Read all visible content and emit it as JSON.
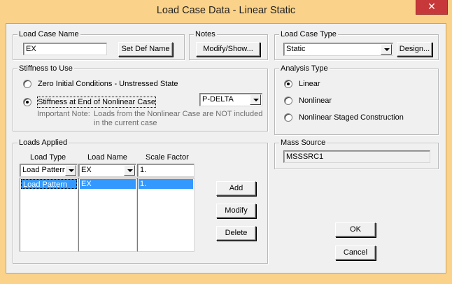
{
  "window": {
    "title": "Load Case Data - Linear Static",
    "close_glyph": "✕"
  },
  "load_case_name": {
    "legend": "Load Case Name",
    "value": "EX",
    "set_def_button": "Set Def Name"
  },
  "notes": {
    "legend": "Notes",
    "button": "Modify/Show..."
  },
  "load_case_type": {
    "legend": "Load Case Type",
    "selected": "Static",
    "design_button": "Design..."
  },
  "stiffness": {
    "legend": "Stiffness to Use",
    "option_zero": "Zero Initial Conditions - Unstressed State",
    "option_nonlinear": "Stiffness at End of Nonlinear Case",
    "nonlinear_case": "P-DELTA",
    "important_label": "Important Note:",
    "important_line1": "Loads from the Nonlinear Case are NOT included",
    "important_line2": "in the current case"
  },
  "analysis_type": {
    "legend": "Analysis Type",
    "options": [
      "Linear",
      "Nonlinear",
      "Nonlinear Staged Construction"
    ],
    "selected": "Linear"
  },
  "loads_applied": {
    "legend": "Loads Applied",
    "headers": [
      "Load Type",
      "Load Name",
      "Scale Factor"
    ],
    "edit_row": {
      "load_type": "Load Pattern",
      "load_name": "EX",
      "scale": "1."
    },
    "rows": [
      {
        "load_type": "Load Pattern",
        "load_name": "EX",
        "scale": "1."
      }
    ],
    "add_button": "Add",
    "modify_button": "Modify",
    "delete_button": "Delete"
  },
  "mass_source": {
    "legend": "Mass Source",
    "value": "MSSSRC1"
  },
  "buttons": {
    "ok": "OK",
    "cancel": "Cancel"
  },
  "colors": {
    "titlebar": "#fbd28a",
    "close": "#c7383a",
    "selection": "#3399ff",
    "dialog": "#f0f0f0"
  }
}
